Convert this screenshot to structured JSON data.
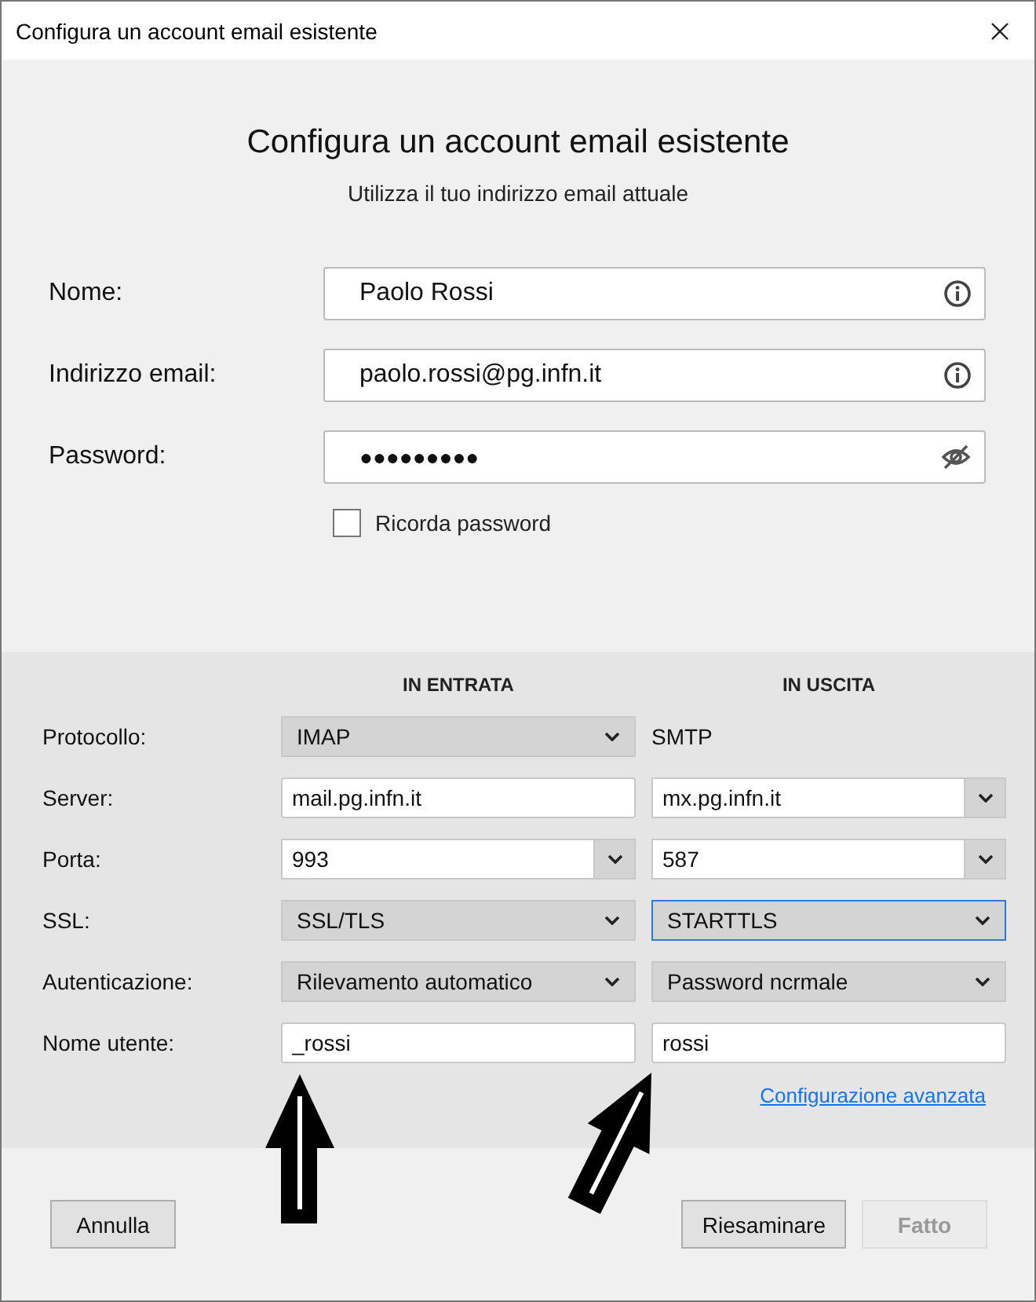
{
  "window": {
    "title": "Configura un account email esistente"
  },
  "heading": "Configura un account email esistente",
  "subtitle": "Utilizza il tuo indirizzo email attuale",
  "fields": [
    {
      "label": "Nome:",
      "value": "Paolo Rossi",
      "kind": "info"
    },
    {
      "label": "Indirizzo email:",
      "value": "paolo.rossi@pg.infn.it",
      "kind": "info"
    },
    {
      "label": "Password:",
      "value": "●●●●●●●●●",
      "kind": "password"
    }
  ],
  "remember_password": {
    "label": "Ricorda password",
    "checked": false
  },
  "server": {
    "columns": [
      "IN ENTRATA",
      "IN USCITA"
    ],
    "rows": [
      {
        "label": "Protocollo:",
        "incoming": {
          "kind": "select",
          "value": "IMAP",
          "focused": false
        },
        "outgoing": {
          "kind": "text",
          "value": "SMTP"
        }
      },
      {
        "label": "Server:",
        "incoming": {
          "kind": "input",
          "value": "mail.pg.infn.it"
        },
        "outgoing": {
          "kind": "combo",
          "value": "mx.pg.infn.it"
        }
      },
      {
        "label": "Porta:",
        "incoming": {
          "kind": "combo",
          "value": "993"
        },
        "outgoing": {
          "kind": "combo",
          "value": "587"
        }
      },
      {
        "label": "SSL:",
        "incoming": {
          "kind": "select",
          "value": "SSL/TLS",
          "focused": false
        },
        "outgoing": {
          "kind": "select",
          "value": "STARTTLS",
          "focused": true
        }
      },
      {
        "label": "Autenticazione:",
        "incoming": {
          "kind": "select",
          "value": "Rilevamento automatico",
          "focused": false
        },
        "outgoing": {
          "kind": "select",
          "value": "Password ncrmale",
          "focused": false
        }
      },
      {
        "label": "Nome utente:",
        "incoming": {
          "kind": "input",
          "value": "_rossi"
        },
        "outgoing": {
          "kind": "input",
          "value": "rossi"
        }
      }
    ]
  },
  "advanced_link": "Configurazione avanzata",
  "buttons": [
    {
      "label": "Annulla",
      "disabled": false
    },
    {
      "label": "Riesaminare",
      "disabled": false
    },
    {
      "label": "Fatto",
      "disabled": true
    }
  ]
}
